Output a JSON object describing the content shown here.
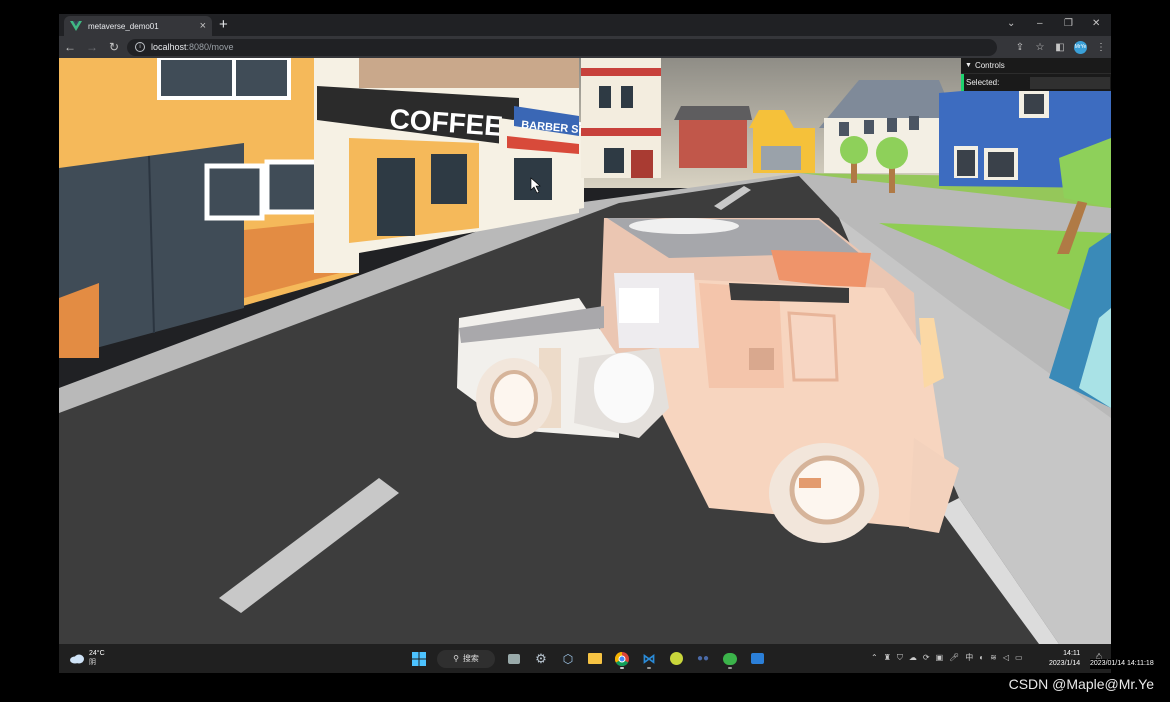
{
  "browser": {
    "tab_title": "metaverse_demo01",
    "new_tab": "+",
    "url_host": "localhost",
    "url_rest": ":8080/move",
    "profile_initials": "MrYe"
  },
  "scene": {
    "coffee_sign": "COFFEE SHOP",
    "barber_sign": "BARBER SHOP"
  },
  "controls": {
    "title": "Controls",
    "selected_label": "Selected:"
  },
  "taskbar": {
    "weather_temp": "24°C",
    "weather_cond": "阴",
    "search_label": "搜索",
    "ime": "中",
    "clock_time": "14:11",
    "clock_date": "2023/1/14"
  },
  "overlay": {
    "timestamp": "2023/01/14 14:11:18",
    "watermark": "CSDN @Maple@Mr.Ye"
  },
  "colors": {
    "chrome_dark": "#202124",
    "chrome_toolbar": "#35363a",
    "controls_accent": "#1ed36f",
    "road": "#3d3d3d",
    "car_body": "#f7d5bf",
    "coffee_sign_bg": "#2b2b2b"
  }
}
